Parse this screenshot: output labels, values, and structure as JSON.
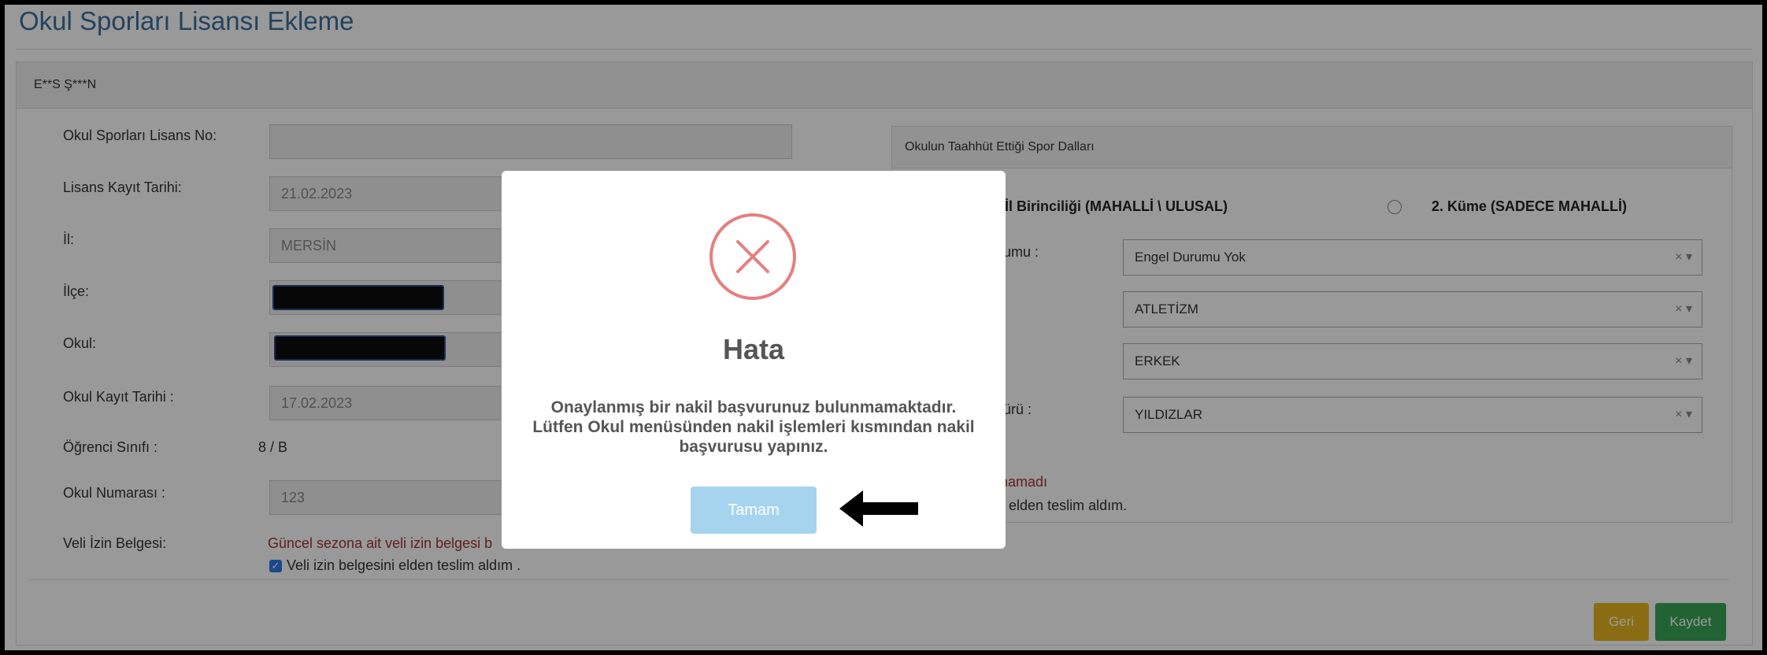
{
  "page": {
    "title": "Okul Sporları Lisansı Ekleme",
    "student_name": "E**S Ş***N"
  },
  "form": {
    "license_no": {
      "label": "Okul Sporları Lisans No:",
      "value": ""
    },
    "license_date": {
      "label": "Lisans Kayıt Tarihi:",
      "value": "21.02.2023"
    },
    "province": {
      "label": "İl:",
      "value": "MERSİN"
    },
    "district": {
      "label": "İlçe:"
    },
    "school": {
      "label": "Okul:"
    },
    "school_reg_date": {
      "label": "Okul Kayıt Tarihi :",
      "value": "17.02.2023"
    },
    "student_class": {
      "label": "Öğrenci Sınıfı :",
      "value": "8 / B"
    },
    "school_number": {
      "label": "Okul Numarası :",
      "value": "123"
    },
    "parent_permission": {
      "label": "Veli İzin Belgesi:",
      "warning": "Güncel sezona ait veli izin belgesi b",
      "checkbox_label": "Veli izin belgesini elden teslim aldım ."
    }
  },
  "right_panel": {
    "heading": "Okulun Taahhüt Ettiği Spor Dalları",
    "radio_1": "İl Birinciliği (MAHALLİ \\ ULUSAL)",
    "radio_2": "2. Küme (SADECE MAHALLİ)",
    "label_disability": "umu :",
    "label_category": "ürü :",
    "select_disability": "Engel Durumu Yok",
    "select_sport": "ATLETİZM",
    "select_gender": "ERKEK",
    "select_category": "YILDIZLAR",
    "select_clear": "×",
    "select_caret": "▾",
    "warning": "lunamadı",
    "delivered_text": "nu elden teslim aldım."
  },
  "buttons": {
    "back": "Geri",
    "save": "Kaydet"
  },
  "modal": {
    "title": "Hata",
    "message": "Onaylanmış bir nakil başvurunuz bulunmamaktadır. Lütfen Okul menüsünden nakil işlemleri kısmından nakil başvurusu yapınız.",
    "ok_button": "Tamam"
  },
  "colors": {
    "title_blue": "#3c6e9c",
    "error_red": "#e57f7f",
    "ok_button": "#a6d4ef",
    "back_button": "#e6b620",
    "save_button": "#3aa655"
  }
}
